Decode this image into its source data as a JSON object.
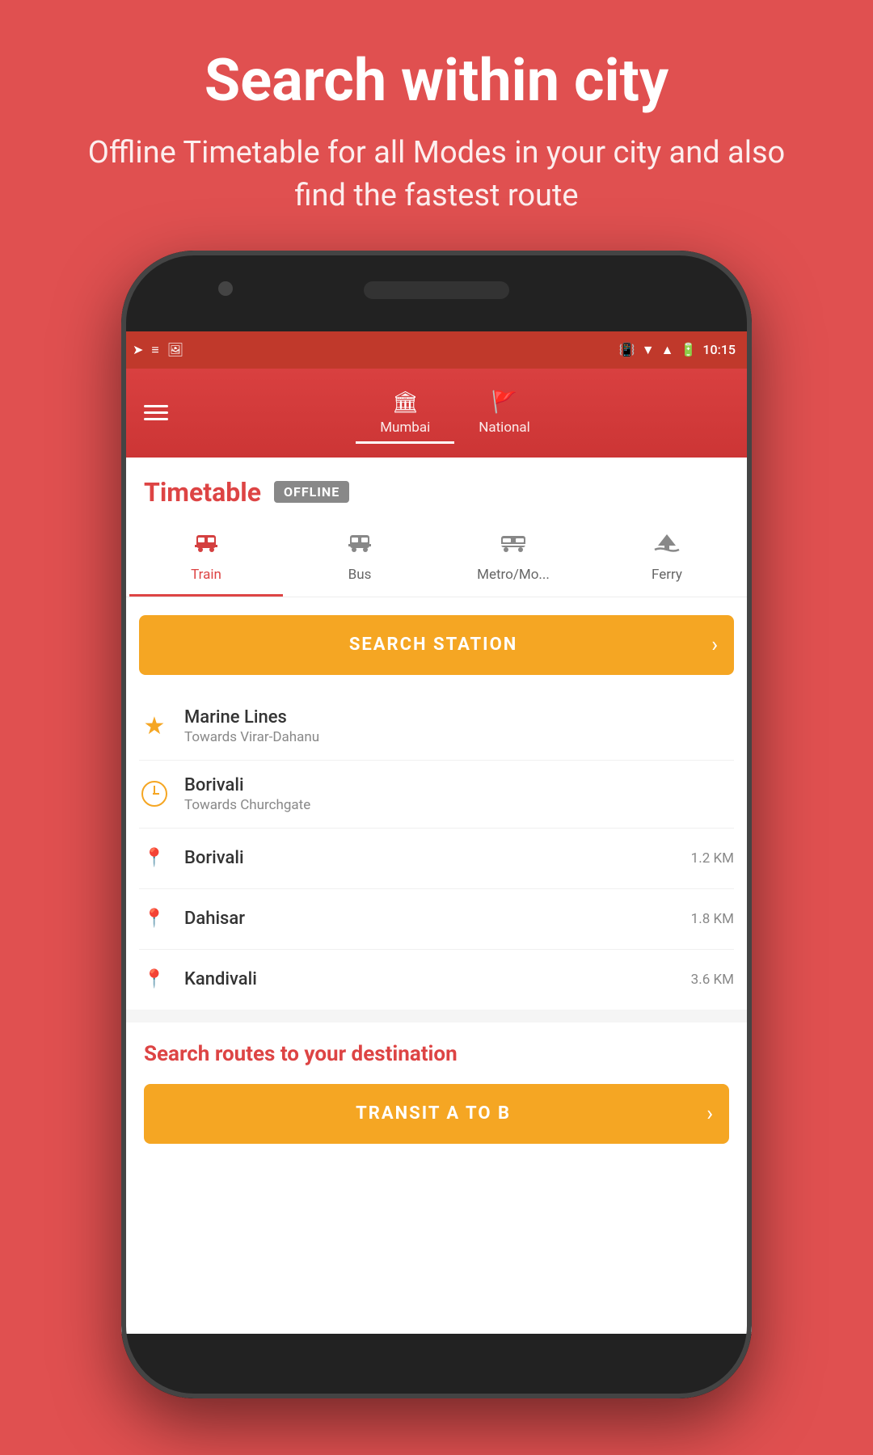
{
  "header": {
    "title": "Search within city",
    "subtitle": "Offline Timetable for all Modes in your city and also find the fastest route"
  },
  "statusBar": {
    "time": "10:15"
  },
  "toolbar": {
    "tabs": [
      {
        "id": "mumbai",
        "label": "Mumbai",
        "icon": "🏛",
        "active": true
      },
      {
        "id": "national",
        "label": "National",
        "icon": "🚩",
        "active": false
      }
    ]
  },
  "timetable": {
    "title": "Timetable",
    "badge": "OFFLINE"
  },
  "transportModes": [
    {
      "id": "train",
      "label": "Train",
      "active": true
    },
    {
      "id": "bus",
      "label": "Bus",
      "active": false
    },
    {
      "id": "metro",
      "label": "Metro/Mo...",
      "active": false
    },
    {
      "id": "ferry",
      "label": "Ferry",
      "active": false
    }
  ],
  "searchStation": {
    "label": "SEARCH STATION"
  },
  "stations": [
    {
      "type": "favorite",
      "name": "Marine Lines",
      "subtitle": "Towards Virar-Dahanu",
      "distance": ""
    },
    {
      "type": "recent",
      "name": "Borivali",
      "subtitle": "Towards Churchgate",
      "distance": ""
    },
    {
      "type": "nearby",
      "name": "Borivali",
      "subtitle": "",
      "distance": "1.2 KM"
    },
    {
      "type": "nearby",
      "name": "Dahisar",
      "subtitle": "",
      "distance": "1.8 KM"
    },
    {
      "type": "nearby",
      "name": "Kandivali",
      "subtitle": "",
      "distance": "3.6 KM"
    }
  ],
  "routesSection": {
    "title": "Search routes to your destination",
    "transitLabel": "TRANSIT A TO B"
  },
  "colors": {
    "brand_red": "#D44040",
    "orange": "#F5A623",
    "background": "#E05050"
  }
}
